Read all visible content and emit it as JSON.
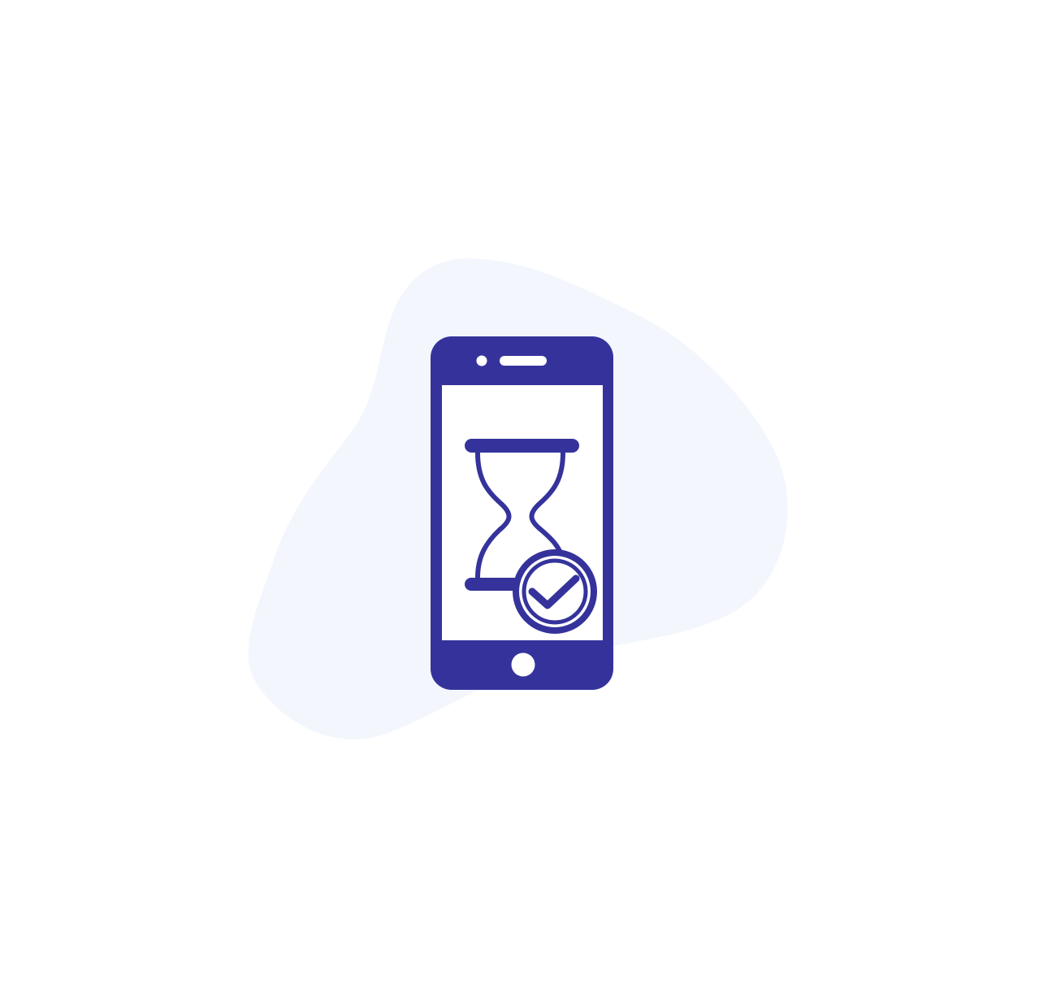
{
  "illustration": {
    "subject": "smartphone-hourglass-check",
    "icons": [
      "blob-background",
      "phone-icon",
      "hourglass-icon",
      "check-circle-icon"
    ],
    "colors": {
      "background": "#ffffff",
      "blob": "#f3f7fd",
      "primary": "#35339b",
      "screen": "#ffffff"
    }
  }
}
